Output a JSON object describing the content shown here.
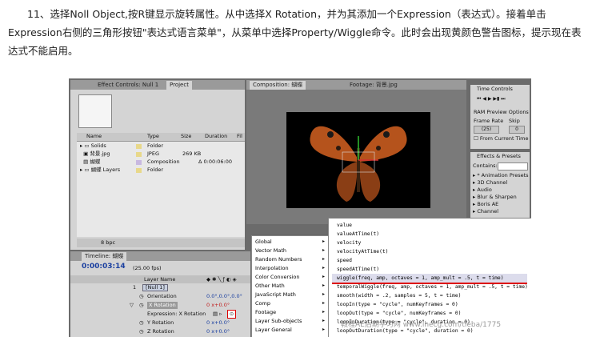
{
  "paragraph": "11、选择Noll Object,按R键显示旋转属性。从中选择X Rotation，并为其添加一个Expression（表达式）。接着单击Expression右侧的三角形按钮\"表达式语言菜单\"，从菜单中选择Property/Wiggle命令。此时会出现黄颜色警告图标，提示现在表达式不能启用。",
  "project": {
    "tabs": [
      "Effect Controls: Null 1",
      "Project"
    ],
    "columns": [
      "Name",
      "Type",
      "Size",
      "Duration",
      "Fil"
    ],
    "items": [
      {
        "name": "Solids",
        "type": "Folder",
        "size": "",
        "duration": "",
        "color": "#e8d88a"
      },
      {
        "name": "背景.jpg",
        "type": "JPEG",
        "size": "269 KB",
        "duration": "",
        "color": "#e8d88a"
      },
      {
        "name": "蝴蝶",
        "type": "Composition",
        "size": "",
        "duration": "Δ 0:00:06:00",
        "color": "#c8b8e0"
      },
      {
        "name": "蝴蝶 Layers",
        "type": "Folder",
        "size": "",
        "duration": "",
        "color": "#e8d88a"
      }
    ],
    "bpc": "8 bpc"
  },
  "comp": {
    "tabs": [
      "Composition: 蝴蝶",
      "Footage: 背景.jpg"
    ]
  },
  "time_controls": {
    "title": "Time Controls",
    "ram_preview": "RAM Preview Options",
    "frame_rate_label": "Frame Rate",
    "skip_label": "Skip",
    "frame_rate_value": "(25)",
    "skip_value": "0",
    "from_current": "From Current Time"
  },
  "effects": {
    "title": "Effects & Presets",
    "contains_label": "Contains:",
    "items": [
      "* Animation Presets",
      "3D Channel",
      "Audio",
      "Blur & Sharpen",
      "Boris AE",
      "Channel"
    ]
  },
  "timeline": {
    "title": "Timeline: 蝴蝶",
    "timecode": "0:00:03:14",
    "fps": "(25.00 fps)",
    "layer_header": "Layer Name",
    "layer_number": "1",
    "layer_name": "[Null 1]",
    "props": [
      {
        "name": "Orientation",
        "value": "0.0°,0.0°,0.0°"
      },
      {
        "name": "X Rotation",
        "value": "0 x+0.0°"
      },
      {
        "name": "Expression: X Rotation",
        "value": ""
      },
      {
        "name": "Y Rotation",
        "value": "0 x+0.0°"
      },
      {
        "name": "Z Rotation",
        "value": "0 x+0.0°"
      }
    ]
  },
  "menu_categories": [
    "Global",
    "Vector Math",
    "Random Numbers",
    "Interpolation",
    "Color Conversion",
    "Other Math",
    "JavaScript Math",
    "Comp",
    "Footage",
    "Layer Sub-objects",
    "Layer General"
  ],
  "menu_items": [
    "value",
    "valueAtTime(t)",
    "velocity",
    "velocityAtTime(t)",
    "speed",
    "speedAtTime(t)",
    "wiggle(freq, amp, octaves = 1, amp_mult = .5, t = time)",
    "temporalWiggle(freq, amp, octaves = 1, amp_mult = .5, t = time)",
    "smooth(width = .2, samples = 5, t = time)",
    "loopIn(type = \"cycle\", numKeyframes = 0)",
    "loopOut(type = \"cycle\", numKeyframes = 0)",
    "loopInDuration(type = \"cycle\", duration = 0)",
    "loopOutDuration(type = \"cycle\", duration = 0)"
  ],
  "watermark": "教程AE后期学习网 www.lhecg.com/tieba/1775"
}
